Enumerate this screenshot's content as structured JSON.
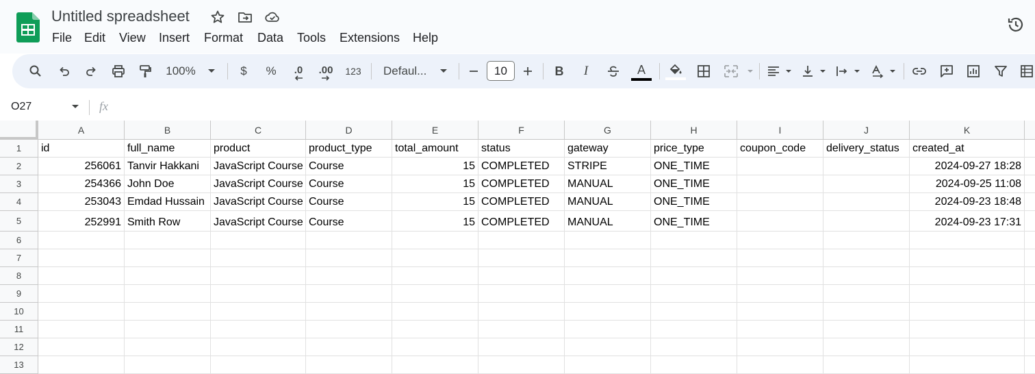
{
  "app": {
    "title": "Untitled spreadsheet",
    "brand_color": "#0f9d58"
  },
  "menu": [
    "File",
    "Edit",
    "View",
    "Insert",
    "Format",
    "Data",
    "Tools",
    "Extensions",
    "Help"
  ],
  "toolbar": {
    "zoom": "100%",
    "currency": "$",
    "percent": "%",
    "decrease_decimal": ".0",
    "increase_decimal": ".00",
    "number_format": "123",
    "font_name": "Defaul...",
    "font_size": "10",
    "bold": "B",
    "italic": "I",
    "text_color_letter": "A"
  },
  "formula_bar": {
    "name_box": "O27",
    "fx": "fx"
  },
  "sheet": {
    "columns": [
      "A",
      "B",
      "C",
      "D",
      "E",
      "F",
      "G",
      "H",
      "I",
      "J",
      "K"
    ],
    "row_numbers": [
      "1",
      "2",
      "3",
      "4",
      "5",
      "6",
      "7",
      "8",
      "9",
      "10",
      "11",
      "12",
      "13"
    ],
    "rows": [
      [
        "id",
        "full_name",
        "product",
        "product_type",
        "total_amount",
        "status",
        "gateway",
        "price_type",
        "coupon_code",
        "delivery_status",
        "created_at"
      ],
      [
        "256061",
        "Tanvir Hakkani",
        "JavaScript Course",
        "Course",
        "15",
        "COMPLETED",
        "STRIPE",
        "ONE_TIME",
        "",
        "",
        "2024-09-27 18:28"
      ],
      [
        "254366",
        "John Doe",
        "JavaScript Course",
        "Course",
        "15",
        "COMPLETED",
        "MANUAL",
        "ONE_TIME",
        "",
        "",
        "2024-09-25 11:08"
      ],
      [
        "253043",
        "Emdad Hussain",
        "JavaScript Course",
        "Course",
        "15",
        "COMPLETED",
        "MANUAL",
        "ONE_TIME",
        "",
        "",
        "2024-09-23 18:48"
      ],
      [
        "252991",
        "Smith Row",
        "JavaScript Course",
        "Course",
        "15",
        "COMPLETED",
        "MANUAL",
        "ONE_TIME",
        "",
        "",
        "2024-09-23 17:31"
      ]
    ]
  }
}
